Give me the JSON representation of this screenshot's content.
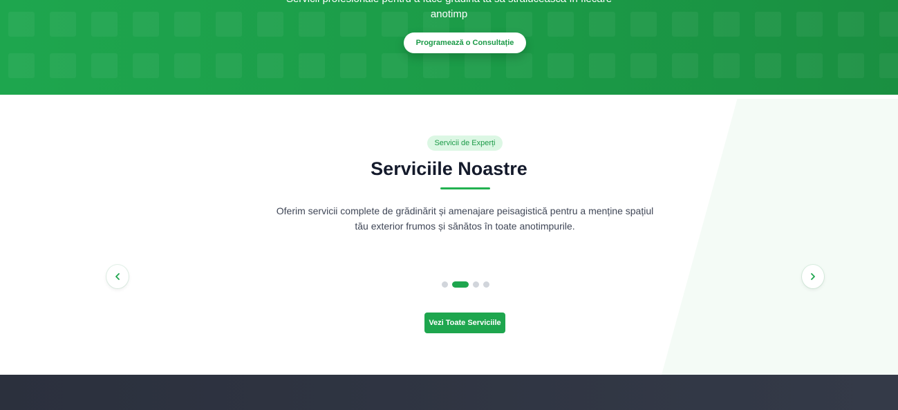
{
  "hero": {
    "line1": "Servicii profesionale pentru a face grădina ta să strălucească în fiecare",
    "line2": "anotimp",
    "cta_label": "Programează o Consultație"
  },
  "services": {
    "badge": "Servicii de Experți",
    "title": "Serviciile Noastre",
    "description": "Oferim servicii complete de grădinărit și amenajare peisagistică pentru a menține spațiul tău exterior frumos și sănătos în toate anotimpurile.",
    "prev_icon": "chevron-left-icon",
    "next_icon": "chevron-right-icon",
    "carousel": {
      "slide_count": 4,
      "active_index": 1
    },
    "view_all_label": "Vezi Toate Serviciile"
  },
  "colors": {
    "brand_green": "#1ea64e",
    "badge_bg": "#dcf7e4",
    "title_text": "#141a2b",
    "footer_bg": "#2b303d"
  }
}
